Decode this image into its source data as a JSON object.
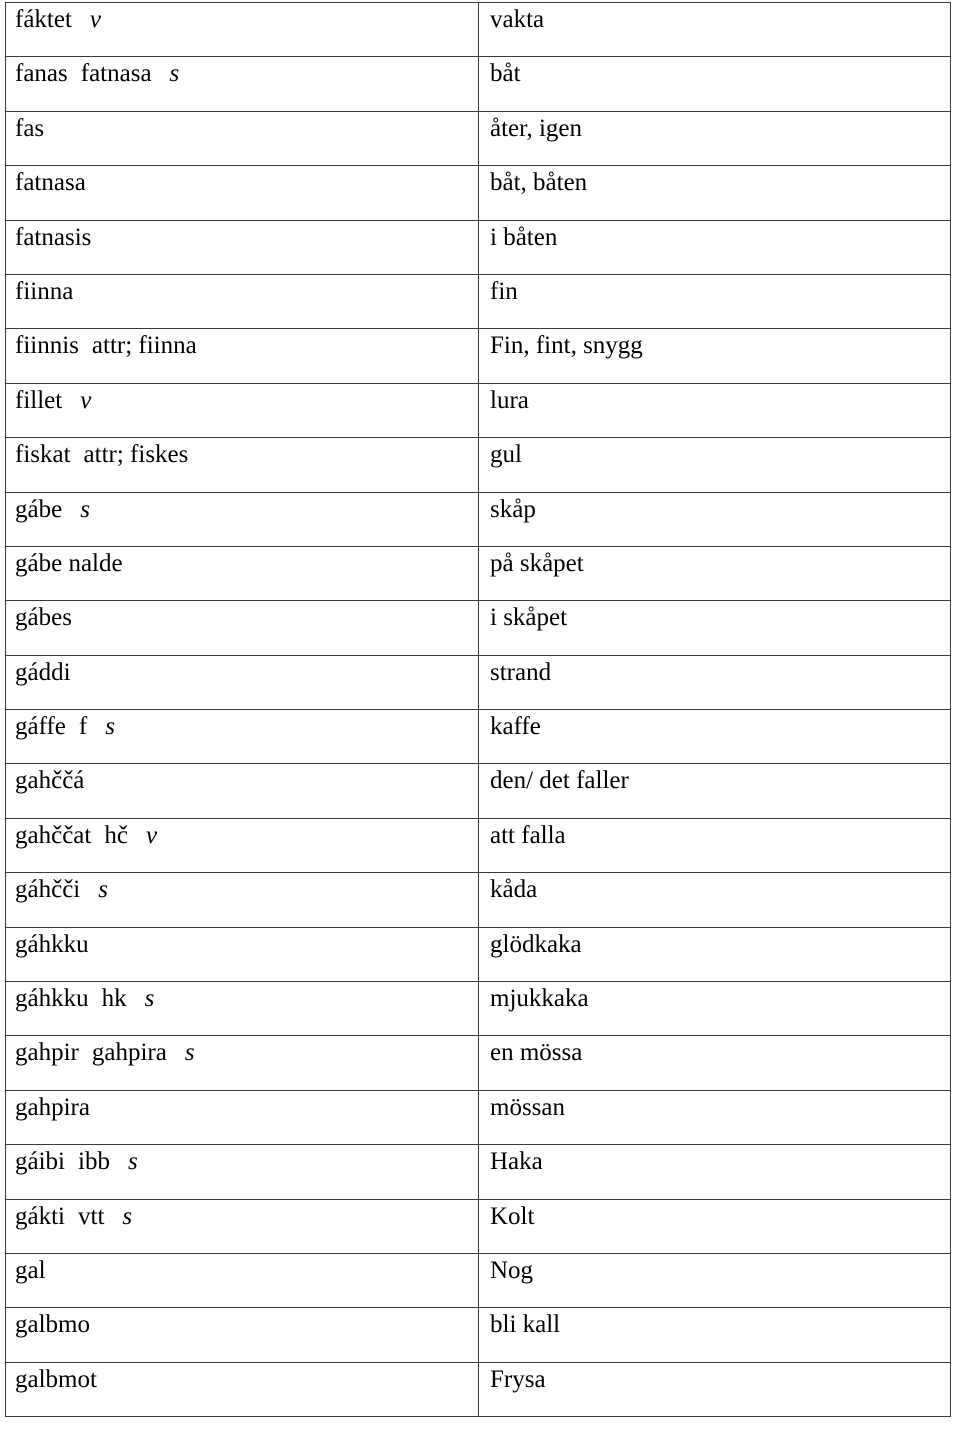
{
  "document": {
    "type": "glossary-table",
    "columns": [
      "term",
      "translation"
    ],
    "language_pair": "Northern Sámi – Swedish"
  },
  "rows": [
    {
      "headword": "fáktet",
      "stem": "",
      "pos": "v",
      "gloss": "vakta"
    },
    {
      "headword": "fanas",
      "stem": "fatnasa",
      "pos": "s",
      "gloss": "båt"
    },
    {
      "headword": "fas",
      "stem": "",
      "pos": "",
      "gloss": "åter, igen"
    },
    {
      "headword": "fatnasa",
      "stem": "",
      "pos": "",
      "gloss": "båt, båten"
    },
    {
      "headword": "fatnasis",
      "stem": "",
      "pos": "",
      "gloss": "i båten"
    },
    {
      "headword": "fiinna",
      "stem": "",
      "pos": "",
      "gloss": "fin"
    },
    {
      "headword": "fiinnis",
      "stem": "attr; fiinna",
      "pos": "",
      "gloss": "Fin, fint, snygg"
    },
    {
      "headword": "fillet",
      "stem": "",
      "pos": "v",
      "gloss": "lura"
    },
    {
      "headword": "fiskat",
      "stem": "attr; fiskes",
      "pos": "",
      "gloss": "gul"
    },
    {
      "headword": "gábe",
      "stem": "",
      "pos": "s",
      "gloss": "skåp"
    },
    {
      "headword": "gábe nalde",
      "stem": "",
      "pos": "",
      "gloss": "på skåpet"
    },
    {
      "headword": "gábes",
      "stem": "",
      "pos": "",
      "gloss": "i skåpet"
    },
    {
      "headword": "gáddi",
      "stem": "",
      "pos": "",
      "gloss": "strand"
    },
    {
      "headword": "gáffe",
      "stem": "f",
      "pos": "s",
      "gloss": "kaffe"
    },
    {
      "headword": "gahččá",
      "stem": "",
      "pos": "",
      "gloss": "den/ det faller"
    },
    {
      "headword": "gahččat",
      "stem": "hč",
      "pos": "v",
      "gloss": "att falla"
    },
    {
      "headword": "gáhčči",
      "stem": "",
      "pos": "s",
      "gloss": "kåda"
    },
    {
      "headword": "gáhkku",
      "stem": "",
      "pos": "",
      "gloss": "glödkaka"
    },
    {
      "headword": "gáhkku",
      "stem": "hk",
      "pos": "s",
      "gloss": "mjukkaka"
    },
    {
      "headword": "gahpir",
      "stem": "gahpira",
      "pos": "s",
      "gloss": "en mössa"
    },
    {
      "headword": "gahpira",
      "stem": "",
      "pos": "",
      "gloss": "mössan"
    },
    {
      "headword": "gáibi",
      "stem": "ibb",
      "pos": "s",
      "gloss": "Haka"
    },
    {
      "headword": "gákti",
      "stem": "vtt",
      "pos": "s",
      "gloss": "Kolt"
    },
    {
      "headword": "gal",
      "stem": "",
      "pos": "",
      "gloss": "Nog"
    },
    {
      "headword": "galbmo",
      "stem": "",
      "pos": "",
      "gloss": "bli kall"
    },
    {
      "headword": "galbmot",
      "stem": "",
      "pos": "",
      "gloss": "Frysa"
    }
  ],
  "colors": {
    "page_background": "#ffffff",
    "text": "#000000",
    "rule": "#3b3b3b"
  }
}
